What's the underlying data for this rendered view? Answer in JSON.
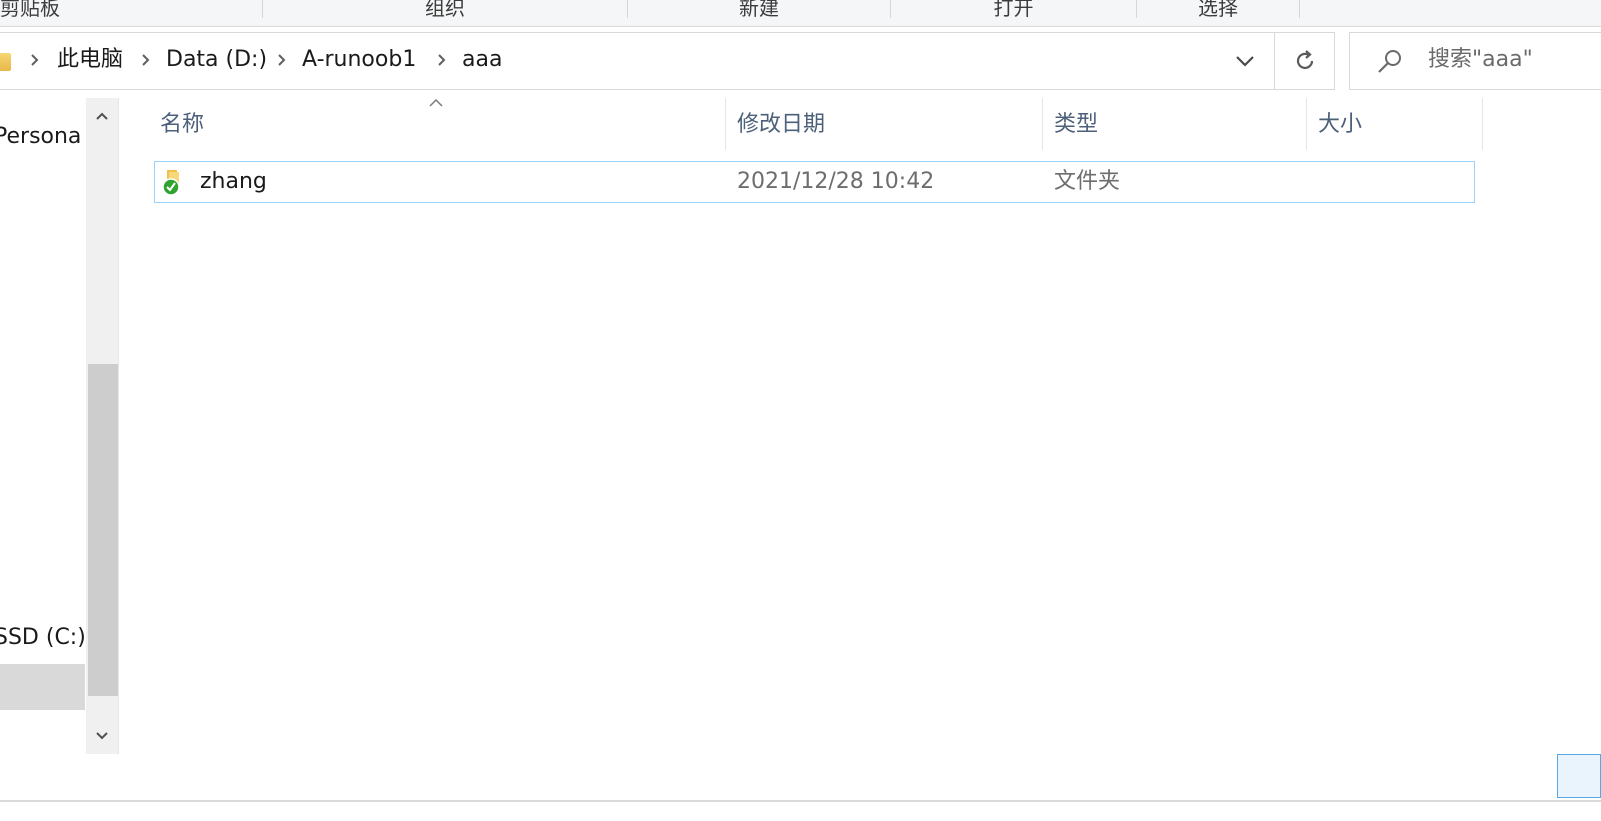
{
  "ribbon": {
    "groups": [
      "剪贴板",
      "组织",
      "新建",
      "打开",
      "选择"
    ]
  },
  "address_bar": {
    "breadcrumbs": [
      "此电脑",
      "Data (D:)",
      "A-runoob1",
      "aaa"
    ]
  },
  "search": {
    "placeholder": "搜索\"aaa\""
  },
  "nav_pane": {
    "items": [
      "Persona",
      "SSD (C:)"
    ]
  },
  "file_list": {
    "columns": [
      "名称",
      "修改日期",
      "类型",
      "大小"
    ],
    "rows": [
      {
        "name": "zhang",
        "modified": "2021/12/28 10:42",
        "type": "文件夹",
        "size": ""
      }
    ]
  },
  "colors": {
    "accent": "#99d1ff",
    "header_text": "#4c607a",
    "sync_badge": "#2fa32f",
    "folder": "#f0c14b"
  },
  "icons": [
    "folder-icon",
    "chevron-right-icon",
    "chevron-down-icon",
    "refresh-icon",
    "search-icon",
    "sync-check-icon",
    "scroll-up-icon",
    "scroll-down-icon",
    "sort-ascending-icon"
  ]
}
